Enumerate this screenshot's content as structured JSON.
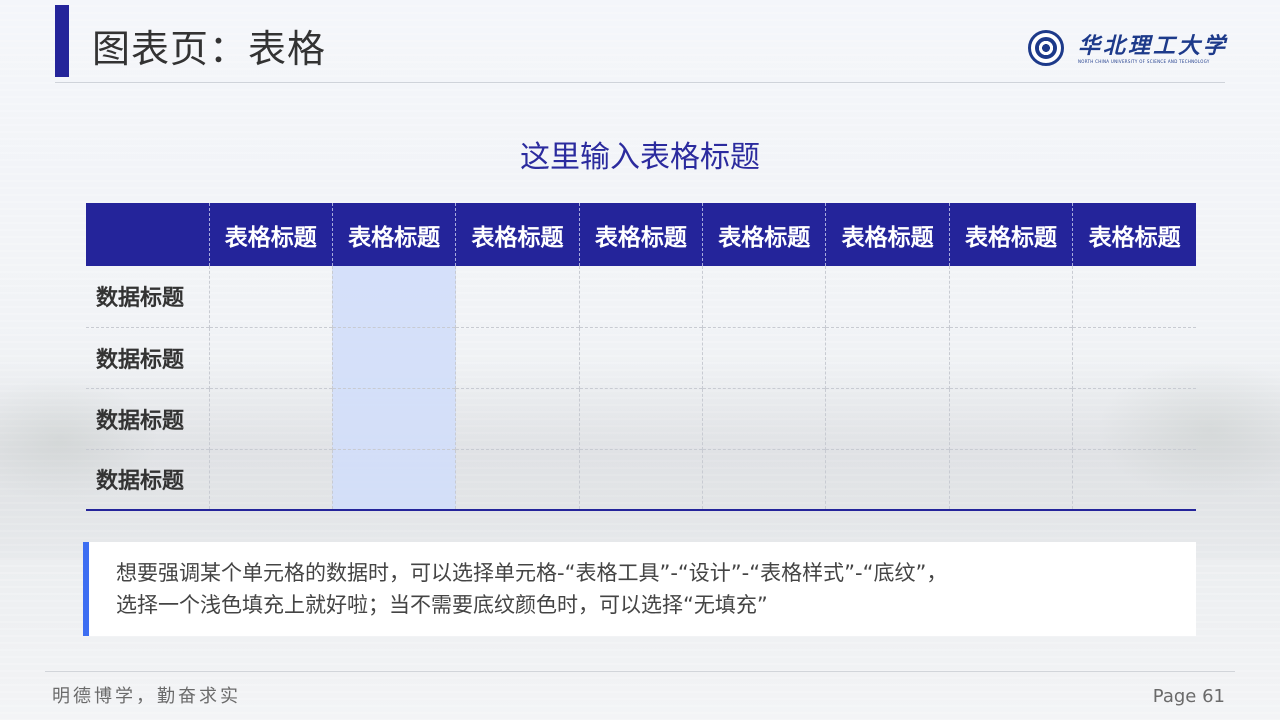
{
  "header": {
    "title": "图表页：表格",
    "university_name_cn": "华北理工大学",
    "university_name_en": "NORTH CHINA UNIVERSITY OF SCIENCE AND TECHNOLOGY"
  },
  "table": {
    "title": "这里输入表格标题",
    "header_corner": "",
    "column_headers": [
      "表格标题",
      "表格标题",
      "表格标题",
      "表格标题",
      "表格标题",
      "表格标题",
      "表格标题",
      "表格标题"
    ],
    "rows": [
      {
        "label": "数据标题",
        "cells": [
          "",
          "",
          "",
          "",
          "",
          "",
          "",
          ""
        ]
      },
      {
        "label": "数据标题",
        "cells": [
          "",
          "",
          "",
          "",
          "",
          "",
          "",
          ""
        ]
      },
      {
        "label": "数据标题",
        "cells": [
          "",
          "",
          "",
          "",
          "",
          "",
          "",
          ""
        ]
      },
      {
        "label": "数据标题",
        "cells": [
          "",
          "",
          "",
          "",
          "",
          "",
          "",
          ""
        ]
      }
    ],
    "highlighted_column_index": 1,
    "header_color": "#24249a",
    "highlight_color": "#d2defa"
  },
  "note": {
    "line1": "想要强调某个单元格的数据时，可以选择单元格-“表格工具”-“设计”-“表格样式”-“底纹”，",
    "line2": "选择一个浅色填充上就好啦；当不需要底纹颜色时，可以选择“无填充”",
    "accent_color": "#3d6ef2"
  },
  "footer": {
    "motto": "明德博学，勤奋求实",
    "page": "Page 61"
  }
}
